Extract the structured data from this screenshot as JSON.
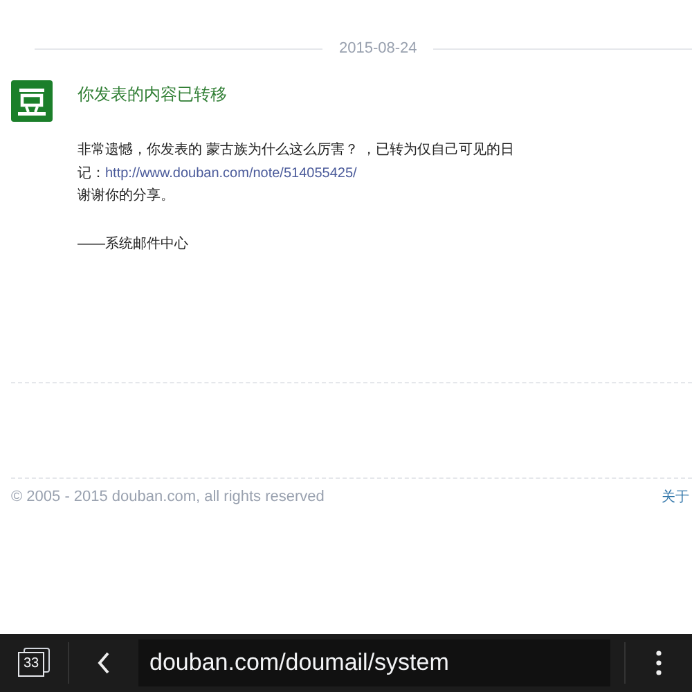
{
  "date": "2015-08-24",
  "message": {
    "title": "你发表的内容已转移",
    "body_text": "非常遗憾，你发表的 蒙古族为什么这么厉害？ ，已转为仅自己可见的日记：",
    "link": "http://www.douban.com/note/514055425/",
    "thanks": "谢谢你的分享。",
    "signature": "——系统邮件中心"
  },
  "footer": {
    "copyright": "© 2005 - 2015 douban.com, all rights reserved",
    "link": "关于"
  },
  "browser_bar": {
    "tab_count": "33",
    "url": "douban.com/doumail/system"
  }
}
